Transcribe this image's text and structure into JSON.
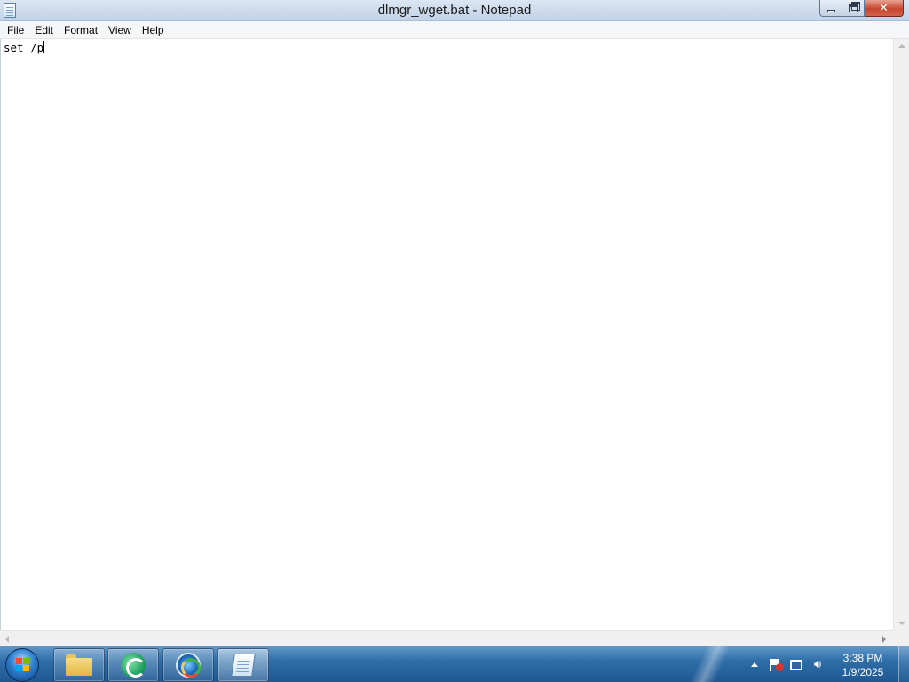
{
  "window": {
    "title": "dlmgr_wget.bat - Notepad",
    "icon": "notepad-icon",
    "controls": [
      "minimize-icon",
      "maximize-icon",
      "close-icon"
    ]
  },
  "menu": {
    "file": "File",
    "edit": "Edit",
    "format": "Format",
    "view": "View",
    "help": "Help"
  },
  "editor": {
    "content": "set /p",
    "font": "monospace"
  },
  "taskbar": {
    "pinned": [
      {
        "name": "Windows Explorer",
        "icon": "folder-icon"
      },
      {
        "name": "Green app",
        "icon": "green-circle-icon"
      },
      {
        "name": "Chrome",
        "icon": "chrome-icon"
      },
      {
        "name": "Notepad",
        "icon": "notepad-icon",
        "active": true
      }
    ],
    "tray": {
      "icons": [
        "show-hidden-icons-icon",
        "action-center-flag-icon",
        "network-icon",
        "volume-icon"
      ]
    },
    "clock": {
      "time": "3:38 PM",
      "date": "1/9/2025"
    }
  },
  "colors": {
    "taskbar": "#2f6ea8",
    "close_button": "#c7452d",
    "titlebar": "#cfdcec"
  }
}
